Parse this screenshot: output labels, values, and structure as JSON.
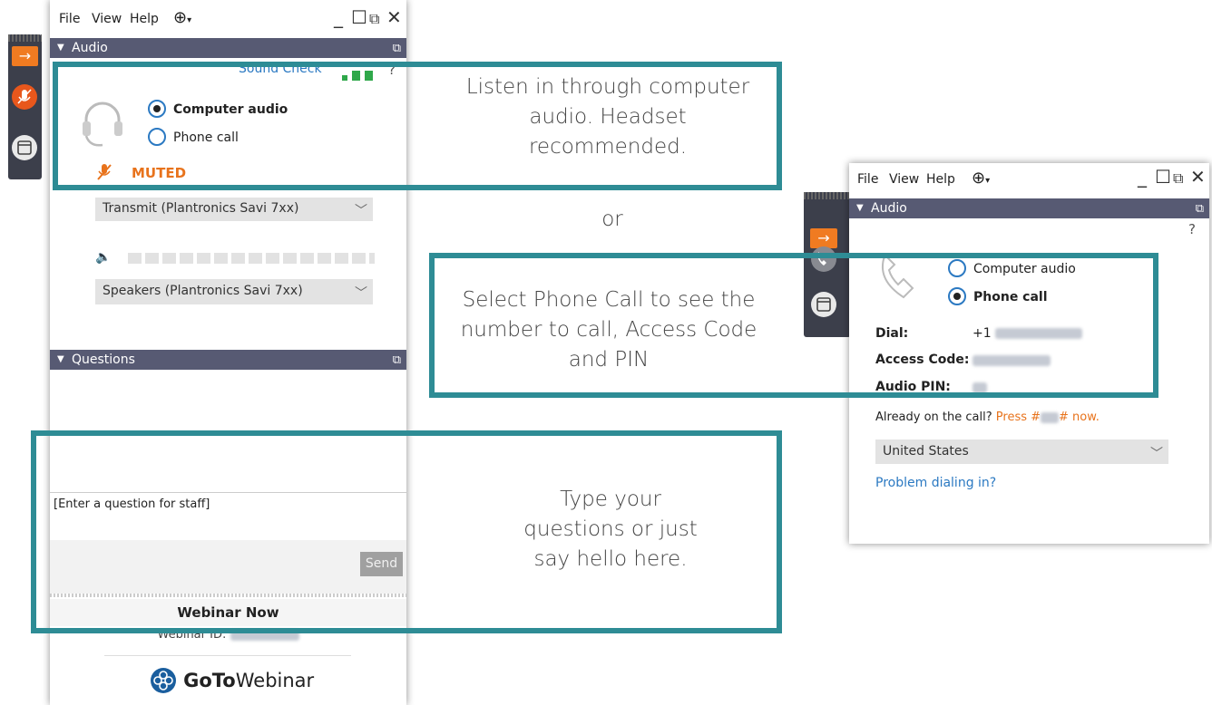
{
  "left_window": {
    "menu": [
      "File",
      "View",
      "Help"
    ],
    "audio_header": "Audio",
    "sound_check": "Sound Check",
    "audio_options": [
      {
        "label": "Computer audio",
        "selected": true
      },
      {
        "label": "Phone call",
        "selected": false
      }
    ],
    "muted_label": "MUTED",
    "mic_device": "Transmit (Plantronics Savi 7xx)",
    "speaker_device": "Speakers (Plantronics Savi 7xx)",
    "questions_header": "Questions",
    "question_placeholder": "[Enter a question for staff]",
    "send_label": "Send",
    "webinar_title": "Webinar Now",
    "webinar_id_label": "Webinar ID:",
    "brand": {
      "goto": "GoTo",
      "webinar": "Webinar"
    },
    "colors": {
      "header_bg": "#575a73",
      "muted": "#e8731c",
      "link": "#2b79c2"
    }
  },
  "right_window": {
    "menu": [
      "File",
      "View",
      "Help"
    ],
    "audio_header": "Audio",
    "help": "?",
    "audio_options": [
      {
        "label": "Computer audio",
        "selected": false
      },
      {
        "label": "Phone call",
        "selected": true
      }
    ],
    "dial_label": "Dial:",
    "dial_prefix": "+1",
    "access_code_label": "Access Code:",
    "audio_pin_label": "Audio PIN:",
    "already_on_call": "Already on the call?",
    "press_prefix": "Press #",
    "press_suffix": "# now.",
    "country": "United States",
    "problem_link": "Problem dialing in?"
  },
  "callouts": {
    "computer_audio": "Listen in through computer audio. Headset recommended.",
    "or": "or",
    "phone_call": "Select Phone Call to see the number to call, Access Code and PIN",
    "questions": "Type your questions or just say hello here."
  },
  "colors": {
    "callout_border": "#2e8c95",
    "toolbar_orange": "#f07b21",
    "toolbar_bg": "#3c3f4b"
  }
}
